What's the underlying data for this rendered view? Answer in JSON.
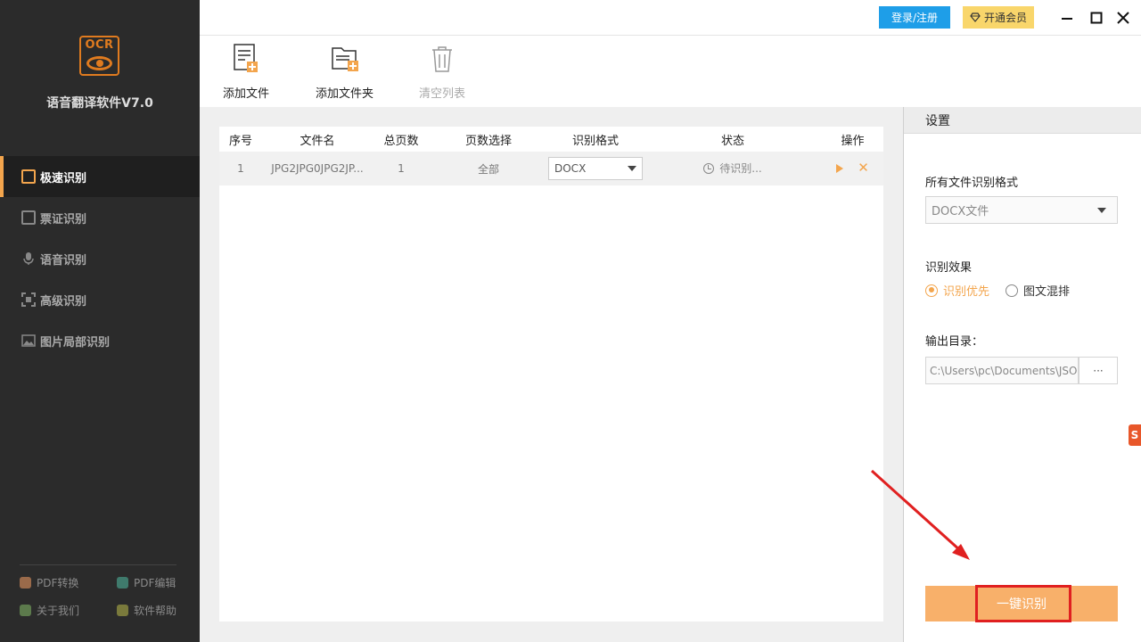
{
  "app": {
    "logo_text": "OCR",
    "title": "语音翻译软件V7.0"
  },
  "sidebar": {
    "items": [
      {
        "label": "极速识别",
        "active": true,
        "icon": "lightning-edit-icon"
      },
      {
        "label": "票证识别",
        "active": false,
        "icon": "ticket-icon"
      },
      {
        "label": "语音识别",
        "active": false,
        "icon": "microphone-icon"
      },
      {
        "label": "高级识别",
        "active": false,
        "icon": "scan-frame-icon"
      },
      {
        "label": "图片局部识别",
        "active": false,
        "icon": "image-icon"
      }
    ],
    "links": [
      {
        "label": "PDF转换",
        "icon": "pdf-convert-icon",
        "color": "#b07a5a"
      },
      {
        "label": "PDF编辑",
        "icon": "pdf-edit-icon",
        "color": "#4a8a7a"
      },
      {
        "label": "关于我们",
        "icon": "info-icon",
        "color": "#6a8a5a"
      },
      {
        "label": "软件帮助",
        "icon": "help-icon",
        "color": "#8a8a4a"
      }
    ]
  },
  "topbar": {
    "login_label": "登录/注册",
    "vip_label": "开通会员",
    "colors": {
      "login": "#1e9ee8",
      "vip": "#f9d66b"
    }
  },
  "toolbar": {
    "add_file": "添加文件",
    "add_folder": "添加文件夹",
    "clear_list": "清空列表"
  },
  "table": {
    "headers": [
      "序号",
      "文件名",
      "总页数",
      "页数选择",
      "识别格式",
      "状态",
      "操作"
    ],
    "rows": [
      {
        "index": "1",
        "filename": "JPG2JPG0JPG2JP...",
        "pages": "1",
        "page_select": "全部",
        "format": "DOCX",
        "status": "待识别..."
      }
    ]
  },
  "settings": {
    "title": "设置",
    "format_label": "所有文件识别格式",
    "format_value": "DOCX文件",
    "effect_label": "识别效果",
    "effect_options": [
      {
        "label": "识别优先",
        "selected": true
      },
      {
        "label": "图文混排",
        "selected": false
      }
    ],
    "output_label": "输出目录：",
    "output_path": "C:\\Users\\pc\\Documents\\JSO",
    "browse_label": "···",
    "run_label": "一键识别"
  },
  "accent_color": "#f3a54d"
}
